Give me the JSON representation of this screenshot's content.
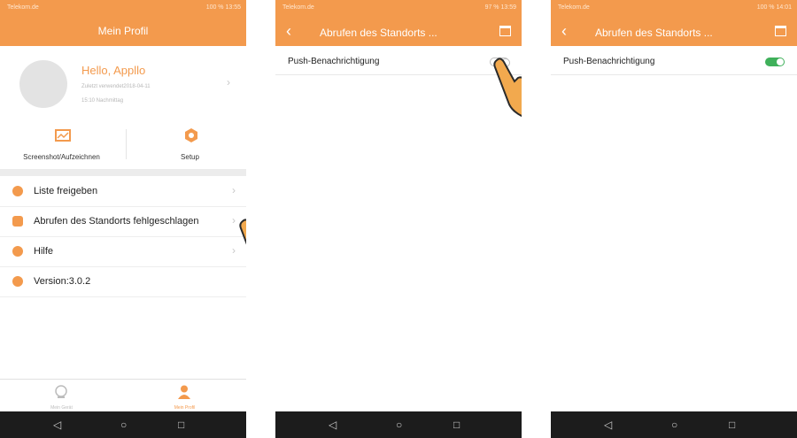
{
  "status": {
    "carrier": "Telekom.de",
    "p1": "100 % 13:55",
    "p2": "97 % 13:59",
    "p3": "100 % 14:01"
  },
  "profile_screen": {
    "title": "Mein Profil",
    "greeting": "Hello, Appllo",
    "last_used": "Zuletzt verwendet2018-04-11",
    "last_time": "15:10 Nachmittag",
    "quick": [
      {
        "label": "Screenshot/Aufzeichnen",
        "icon": "screenshot-icon"
      },
      {
        "label": "Setup",
        "icon": "gear-icon"
      }
    ],
    "menu": [
      {
        "label": "Liste freigeben",
        "icon": "share-list-icon"
      },
      {
        "label": "Abrufen des Standorts fehlgeschlagen",
        "icon": "location-failed-icon"
      },
      {
        "label": "Hilfe",
        "icon": "help-icon"
      },
      {
        "label": "Version:3.0.2",
        "icon": "info-icon"
      }
    ],
    "tabs": [
      {
        "label": "Mein Gerät",
        "icon": "device-icon",
        "active": false
      },
      {
        "label": "Mein Profil",
        "icon": "person-icon",
        "active": true
      }
    ]
  },
  "location_screen": {
    "title": "Abrufen des Standorts ...",
    "push_label": "Push-Benachrichtigung"
  },
  "toggle_states": {
    "screen2": "off",
    "screen3": "on"
  },
  "colors": {
    "accent": "#f39a4d",
    "toggle_on": "#3fb05a",
    "navbar": "#1c1c1c"
  }
}
